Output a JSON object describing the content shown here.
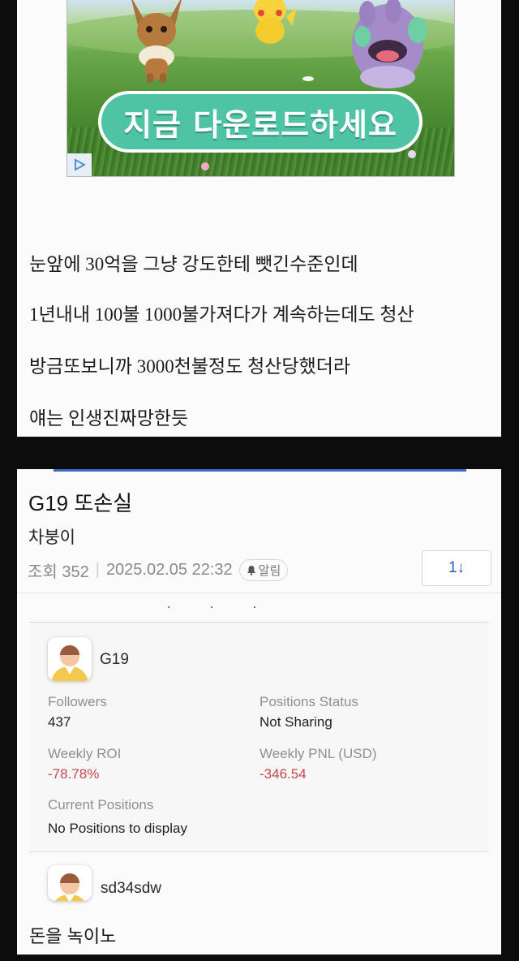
{
  "ad": {
    "cta_label": "지금 다운로드하세요",
    "badge_icon": "ad-choices-icon",
    "button_color": "#4fc4a4"
  },
  "post_text": {
    "lines": [
      "눈앞에 30억을 그냥 강도한테 뺏긴수준인데",
      "1년내내 100불 1000불가져다가 계속하는데도 청산",
      "방금또보니까 3000천불정도 청산당했더라",
      "얘는 인생진짜망한듯"
    ]
  },
  "post": {
    "title": "G19 또손실",
    "author": "차붕이",
    "views_label": "조회 352",
    "datetime": "2025.02.05 22:32",
    "alarm_label": "알림",
    "sort_label": "1↓",
    "accent_color": "#3b6bc7"
  },
  "screenshot_card": {
    "dots": "· · ·",
    "trader": {
      "name": "G19",
      "followers_label": "Followers",
      "followers_value": "437",
      "positions_status_label": "Positions Status",
      "positions_status_value": "Not Sharing",
      "weekly_roi_label": "Weekly ROI",
      "weekly_roi_value": "-78.78%",
      "weekly_pnl_label": "Weekly PNL (USD)",
      "weekly_pnl_value": "-346.54",
      "current_positions_label": "Current Positions",
      "current_positions_value": "No Positions to display",
      "negative_color": "#c3474e"
    },
    "next_trader": {
      "name": "sd34sdw"
    }
  },
  "comment": {
    "text": "돈을 녹이노"
  }
}
